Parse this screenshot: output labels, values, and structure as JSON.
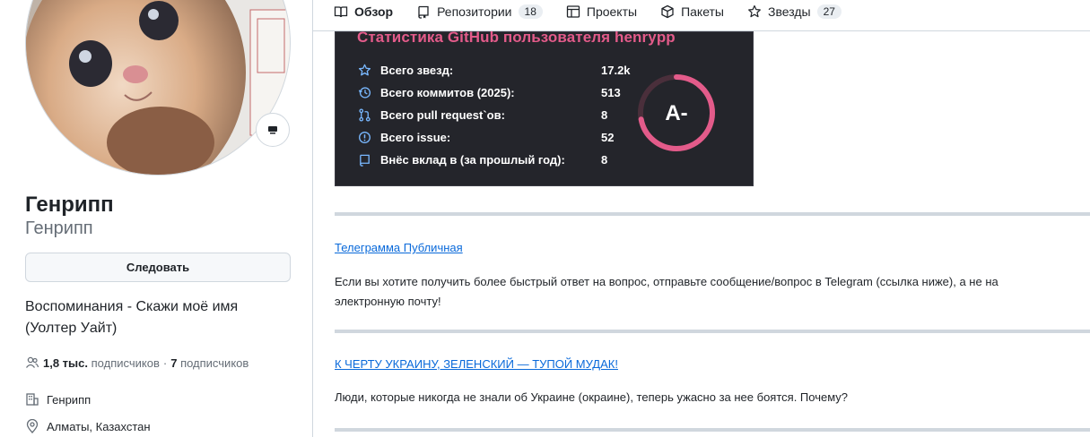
{
  "profile": {
    "name": "Генрипп",
    "login": "Генрипп",
    "follow_label": "Следовать",
    "bio": "Воспоминания - Скажи моё имя (Уолтер Уайт)",
    "followers_count": "1,8 тыс.",
    "followers_label": "подписчиков",
    "separator": "·",
    "following_count": "7",
    "following_label": "подписчиков",
    "company": "Генрипп",
    "location": "Алматы, Казахстан"
  },
  "tabs": [
    {
      "label": "Обзор",
      "icon": "book-icon",
      "active": true
    },
    {
      "label": "Репозитории",
      "icon": "repo-icon",
      "counter": "18"
    },
    {
      "label": "Проекты",
      "icon": "table-icon"
    },
    {
      "label": "Пакеты",
      "icon": "package-icon"
    },
    {
      "label": "Звезды",
      "icon": "star-icon",
      "counter": "27"
    }
  ],
  "stats": {
    "title": "Статистика GitHub пользователя henrypp",
    "rows": [
      {
        "label": "Всего звезд:",
        "value": "17.2k",
        "icon": "star-icon"
      },
      {
        "label": "Всего коммитов (2025):",
        "value": "513",
        "icon": "history-icon"
      },
      {
        "label": "Всего pull request`ов:",
        "value": "8",
        "icon": "pull-request-icon"
      },
      {
        "label": "Всего issue:",
        "value": "52",
        "icon": "issue-icon"
      },
      {
        "label": "Внёс вклад в (за прошлый год):",
        "value": "8",
        "icon": "repo-icon"
      }
    ],
    "rank": "A-",
    "rank_progress": 0.72,
    "colors": {
      "background": "#24252b",
      "title": "#e35b8a",
      "ring": "#e35b8a"
    }
  },
  "posts": [
    {
      "link": "Телеграмма Публичная",
      "text": "Если вы хотите получить более быстрый ответ на вопрос, отправьте сообщение/вопрос в Telegram (ссылка ниже), а не на электронную почту!"
    },
    {
      "link": "К ЧЕРТУ УКРАИНУ, ЗЕЛЕНСКИЙ — ТУПОЙ МУДАК!",
      "text": "Люди, которые никогда не знали об Украине (окраине), теперь ужасно за нее боятся. Почему?"
    }
  ]
}
